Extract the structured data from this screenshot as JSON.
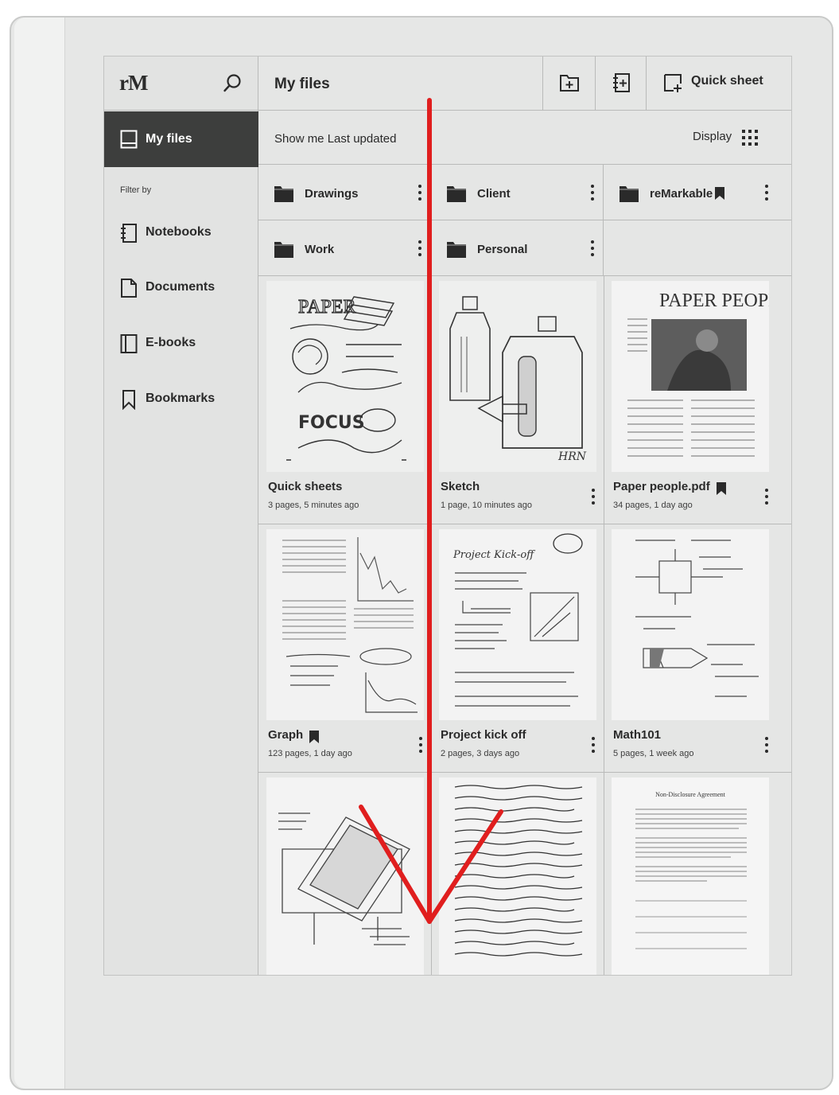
{
  "app": {
    "logo": "rM",
    "title": "My files"
  },
  "toolbar": {
    "quick_sheet_label": "Quick sheet",
    "buttons": [
      "new-folder",
      "new-notebook",
      "quick-sheet"
    ]
  },
  "sidebar": {
    "active_item": "My files",
    "filter_label": "Filter by",
    "items": [
      {
        "label": "Notebooks",
        "icon": "notebook-icon"
      },
      {
        "label": "Documents",
        "icon": "document-icon"
      },
      {
        "label": "E-books",
        "icon": "ebook-icon"
      },
      {
        "label": "Bookmarks",
        "icon": "bookmark-icon"
      }
    ]
  },
  "sortbar": {
    "sort_text": "Show me Last updated",
    "display_label": "Display"
  },
  "folders": [
    {
      "name": "Drawings",
      "bookmarked": false
    },
    {
      "name": "Client",
      "bookmarked": false
    },
    {
      "name": "reMarkable",
      "bookmarked": true
    },
    {
      "name": "Work",
      "bookmarked": false
    },
    {
      "name": "Personal",
      "bookmarked": false
    }
  ],
  "documents": [
    {
      "title": "Quick sheets",
      "meta": "3 pages, 5 minutes ago",
      "bookmarked": false
    },
    {
      "title": "Sketch",
      "meta": "1 page, 10 minutes ago",
      "bookmarked": false
    },
    {
      "title": "Paper people.pdf",
      "meta": "34 pages, 1 day ago",
      "bookmarked": true
    },
    {
      "title": "Graph",
      "meta": "123 pages, 1 day ago",
      "bookmarked": true
    },
    {
      "title": "Project kick off",
      "meta": "2 pages, 3 days ago",
      "bookmarked": false
    },
    {
      "title": "Math101",
      "meta": "5 pages, 1 week ago",
      "bookmarked": false
    }
  ],
  "thumb_text": {
    "quick_sheets_title": "PAPER",
    "quick_sheets_focus": "FOCUS",
    "paper_people_title": "PAPER PEOPLE",
    "project_heading": "Project Kick-off",
    "nda_heading": "Non-Disclosure Agreement"
  },
  "colors": {
    "screen_bg": "#e5e6e5",
    "active_bg": "#3d3e3d",
    "annotation": "#e01e1e"
  }
}
